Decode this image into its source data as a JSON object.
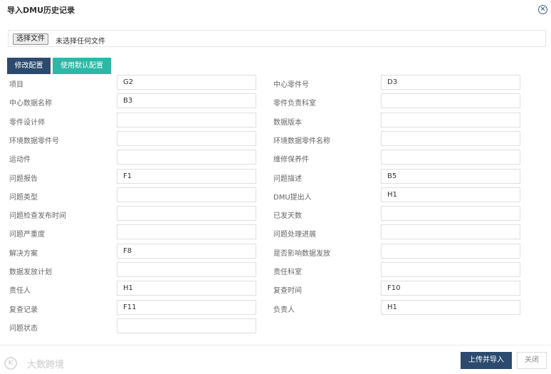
{
  "dialog": {
    "title": "导入DMU历史记录",
    "close_icon": "circle-x-icon"
  },
  "file": {
    "button_label": "选择文件",
    "status": "未选择任何文件"
  },
  "config": {
    "edit_label": "修改配置",
    "default_label": "使用默认配置"
  },
  "fields": [
    {
      "label": "项目",
      "value": "G2"
    },
    {
      "label": "中心零件号",
      "value": "D3"
    },
    {
      "label": "中心数据名称",
      "value": "B3"
    },
    {
      "label": "零件负责科室",
      "value": ""
    },
    {
      "label": "零件设计师",
      "value": ""
    },
    {
      "label": "数据版本",
      "value": ""
    },
    {
      "label": "环境数据零件号",
      "value": ""
    },
    {
      "label": "环境数据零件名称",
      "value": ""
    },
    {
      "label": "运动件",
      "value": ""
    },
    {
      "label": "维修保养件",
      "value": ""
    },
    {
      "label": "问题报告",
      "value": "F1"
    },
    {
      "label": "问题描述",
      "value": "B5"
    },
    {
      "label": "问题类型",
      "value": ""
    },
    {
      "label": "DMU提出人",
      "value": "H1"
    },
    {
      "label": "问题检查发布时间",
      "value": ""
    },
    {
      "label": "已发天数",
      "value": ""
    },
    {
      "label": "问题严重度",
      "value": ""
    },
    {
      "label": "问题处理进展",
      "value": ""
    },
    {
      "label": "解决方案",
      "value": "F8"
    },
    {
      "label": "是否影响数据发放",
      "value": ""
    },
    {
      "label": "数据发放计划",
      "value": ""
    },
    {
      "label": "责任科室",
      "value": ""
    },
    {
      "label": "责任人",
      "value": "H1"
    },
    {
      "label": "复查时间",
      "value": "F10"
    },
    {
      "label": "复查记录",
      "value": "F11"
    },
    {
      "label": "负责人",
      "value": "H1"
    },
    {
      "label": "问题状态",
      "value": ""
    }
  ],
  "footer": {
    "upload_label": "上传并导入",
    "close_label": "关闭"
  },
  "watermark": {
    "text": "大数跨境",
    "logo_icon": "watermark-logo-icon"
  }
}
